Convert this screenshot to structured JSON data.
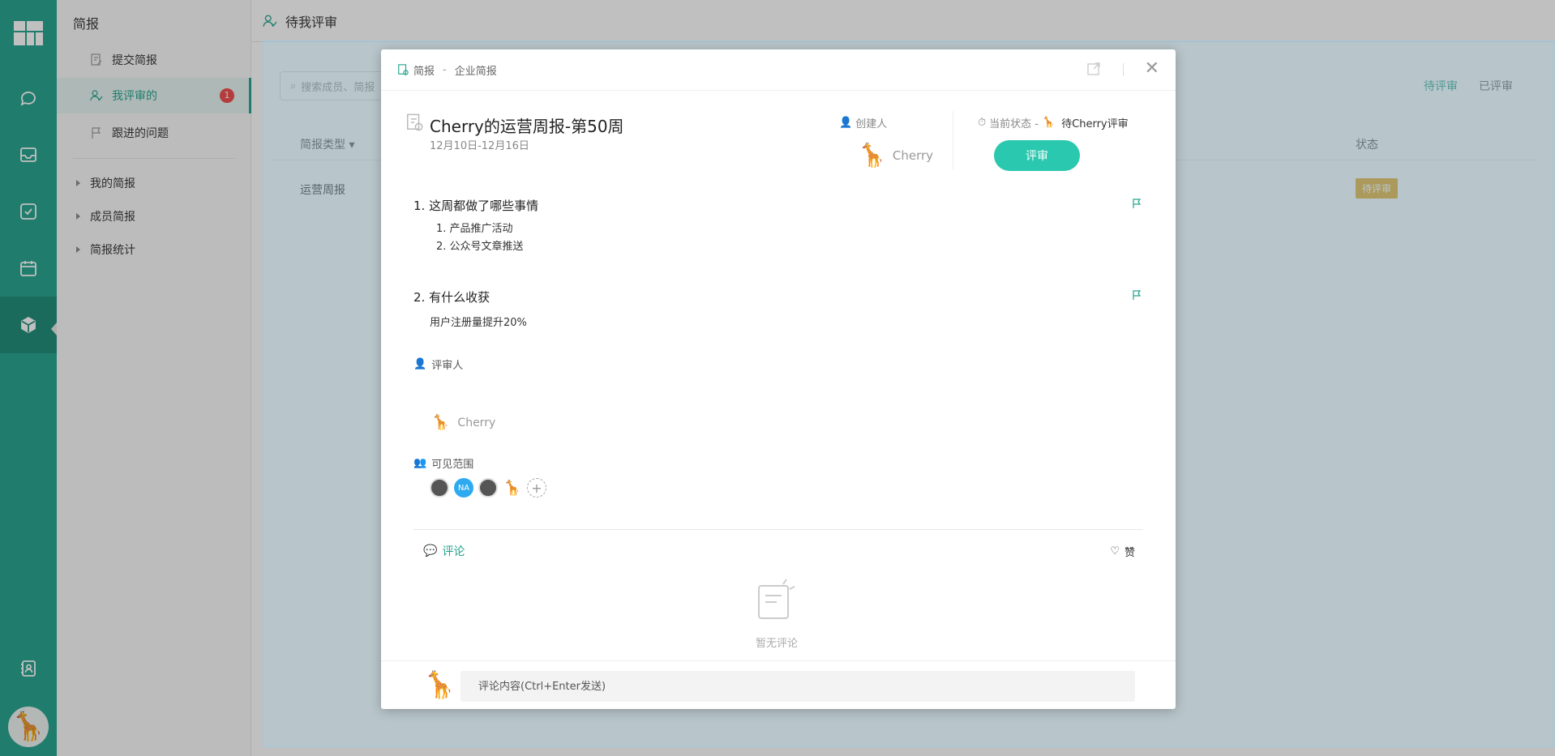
{
  "rail": {
    "icons": [
      "apps-icon",
      "chat-icon",
      "inbox-icon",
      "task-icon",
      "calendar-icon",
      "report-cube-icon",
      "contacts-icon"
    ],
    "avatar": "🦒",
    "brand_color": "#22a38d"
  },
  "sidebar": {
    "title": "简报",
    "items": [
      {
        "label": "提交简报",
        "icon": "edit-doc-icon"
      },
      {
        "label": "我评审的",
        "icon": "user-review-icon",
        "badge": "1"
      },
      {
        "label": "跟进的问题",
        "icon": "flag-icon"
      }
    ],
    "groups": [
      "我的简报",
      "成员简报",
      "简报统计"
    ]
  },
  "main": {
    "title": "待我评审",
    "search_placeholder": "搜索成员、简报",
    "tabs": [
      "待评审",
      "已评审"
    ],
    "table": {
      "headers": [
        "简报类型",
        "状态"
      ],
      "rows": [
        {
          "type": "运营周报",
          "status": "待评审"
        }
      ]
    }
  },
  "modal": {
    "breadcrumb": [
      "简报",
      "企业简报"
    ],
    "report": {
      "title": "Cherry的运营周报-第50周",
      "date_range": "12月10日-12月16日"
    },
    "creator_label": "创建人",
    "creator_name": "Cherry",
    "status_label": "当前状态 -",
    "status_value": "待Cherry评审",
    "review_button": "评审",
    "sections": [
      {
        "question": "1. 这周都做了哪些事情",
        "items": [
          "1.  产品推广活动",
          "2.  公众号文章推送"
        ]
      },
      {
        "question": "2. 有什么收获",
        "answer": "用户注册量提升20%"
      }
    ],
    "reviewer_label": "评审人",
    "reviewer_name": "Cherry",
    "visibility_label": "可见范围",
    "visibility_avatars": [
      "photo",
      "NA",
      "photo",
      "giraffe"
    ],
    "comment_tab": "评论",
    "like_label": "赞",
    "empty_comment": "暂无评论",
    "comment_placeholder": "评论内容(Ctrl+Enter发送)"
  }
}
